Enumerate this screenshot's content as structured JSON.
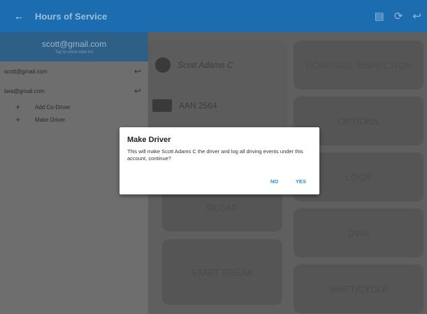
{
  "appbar": {
    "back_icon": "arrow-left-icon",
    "title": "Hours of Service",
    "actions": [
      "connect-icon",
      "refresh-icon",
      "logout-icon"
    ]
  },
  "drawer": {
    "account_email": "scott@gmail.com",
    "account_hint": "Tap to show view list",
    "accounts": [
      {
        "email": "scott@gmail.com",
        "icon": "logout-icon"
      },
      {
        "email": "lara@gmail.com",
        "icon": "logout-icon"
      }
    ],
    "actions": [
      {
        "icon": "plus-icon",
        "label": "Add Co-Driver"
      },
      {
        "icon": "plus-icon",
        "label": "Make Driver"
      }
    ]
  },
  "main": {
    "driver_name": "Scott Adams C",
    "vehicle_id": "AAN 2564",
    "buttons": {
      "roadside": "ROADSIDE INSPECTION",
      "options": "OPTIONS",
      "logs": "LOGS",
      "dvir": "DVIR",
      "shift": "SHIFT/CYCLE",
      "recap": "RECAP",
      "start_break": "START BREAK"
    }
  },
  "dialog": {
    "title": "Make Driver",
    "message": "This will make Scott Adams C the driver and log all driving events under this account, continue?",
    "no_label": "NO",
    "yes_label": "YES"
  },
  "colors": {
    "appbar": "#1c6cb0",
    "dialog_button": "#2a8fd1",
    "overlay": "#5f5f5f"
  }
}
